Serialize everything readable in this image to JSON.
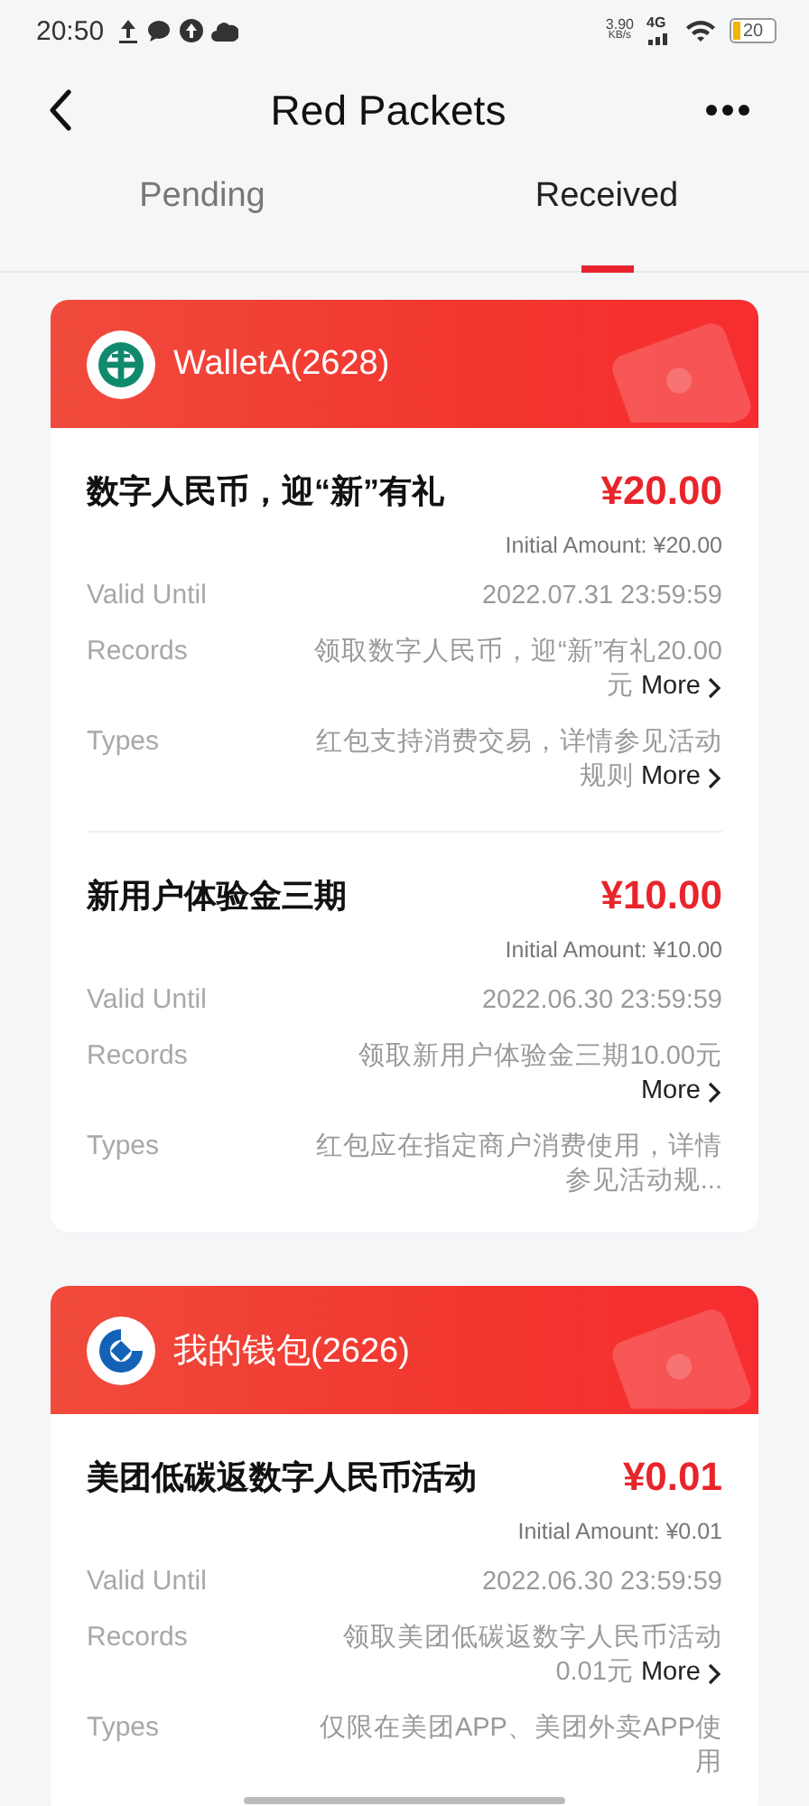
{
  "status_bar": {
    "time": "20:50",
    "speed": "3.90",
    "speed_unit": "KB/s",
    "network": "4G",
    "battery": "20"
  },
  "header": {
    "title": "Red Packets"
  },
  "tabs": [
    {
      "label": "Pending",
      "selected": false
    },
    {
      "label": "Received",
      "selected": true
    }
  ],
  "wallets": [
    {
      "name": "WalletA(2628)",
      "kind": "grain",
      "packets": [
        {
          "title": "数字人民币，迎“新”有礼",
          "amount": "¥20.00",
          "initial_amount": "Initial Amount: ¥20.00",
          "rows": [
            {
              "label": "Valid Until",
              "value": "2022.07.31 23:59:59"
            },
            {
              "label": "Records",
              "value": "领取数字人民币，迎“新”有礼20.00元",
              "more": "More"
            },
            {
              "label": "Types",
              "value": "红包支持消费交易，详情参见活动规则",
              "more": "More"
            }
          ]
        },
        {
          "title": "新用户体验金三期",
          "amount": "¥10.00",
          "initial_amount": "Initial Amount: ¥10.00",
          "rows": [
            {
              "label": "Valid Until",
              "value": "2022.06.30 23:59:59"
            },
            {
              "label": "Records",
              "value": "领取新用户体验金三期10.00元",
              "more": "More"
            },
            {
              "label": "Types",
              "value": "红包应在指定商户消费使用，详情参见活动规..."
            }
          ]
        }
      ]
    },
    {
      "name": "我的钱包(2626)",
      "kind": "ring",
      "packets": [
        {
          "title": "美团低碳返数字人民币活动",
          "amount": "¥0.01",
          "initial_amount": "Initial Amount: ¥0.01",
          "rows": [
            {
              "label": "Valid Until",
              "value": "2022.06.30 23:59:59"
            },
            {
              "label": "Records",
              "value": "领取美团低碳返数字人民币活动0.01元",
              "more": "More"
            },
            {
              "label": "Types",
              "value": "仅限在美团APP、美团外卖APP使用"
            }
          ]
        }
      ]
    }
  ]
}
